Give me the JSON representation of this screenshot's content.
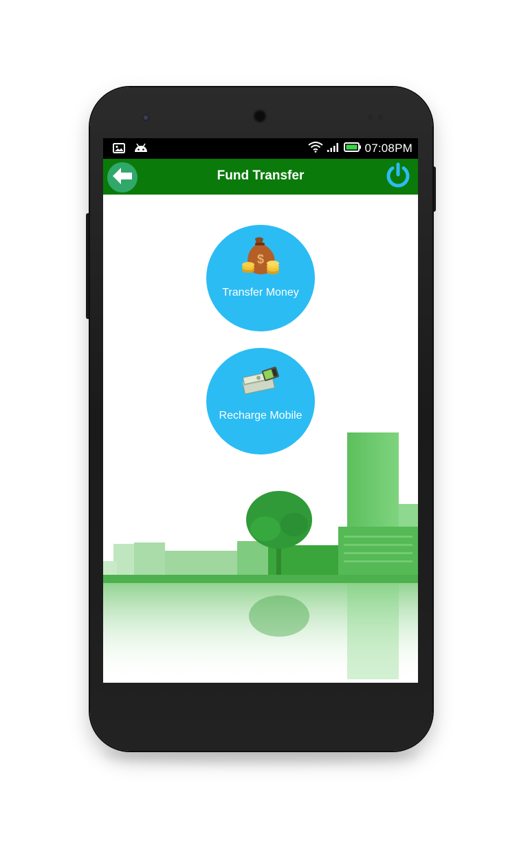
{
  "status_bar": {
    "time": "07:08PM",
    "icons": [
      "gallery-icon",
      "android-icon",
      "wifi-icon",
      "signal-icon",
      "battery-icon"
    ]
  },
  "app_bar": {
    "title": "Fund Transfer",
    "back_icon": "back-arrow-icon",
    "power_icon": "power-icon"
  },
  "actions": [
    {
      "label": "Transfer Money",
      "icon": "money-bag-icon"
    },
    {
      "label": "Recharge Mobile",
      "icon": "cash-phone-icon"
    }
  ],
  "colors": {
    "app_bar": "#0a7a0a",
    "action_circle": "#2bbcf3",
    "back_button": "#2fa86a",
    "power_icon": "#2bbcf3"
  }
}
